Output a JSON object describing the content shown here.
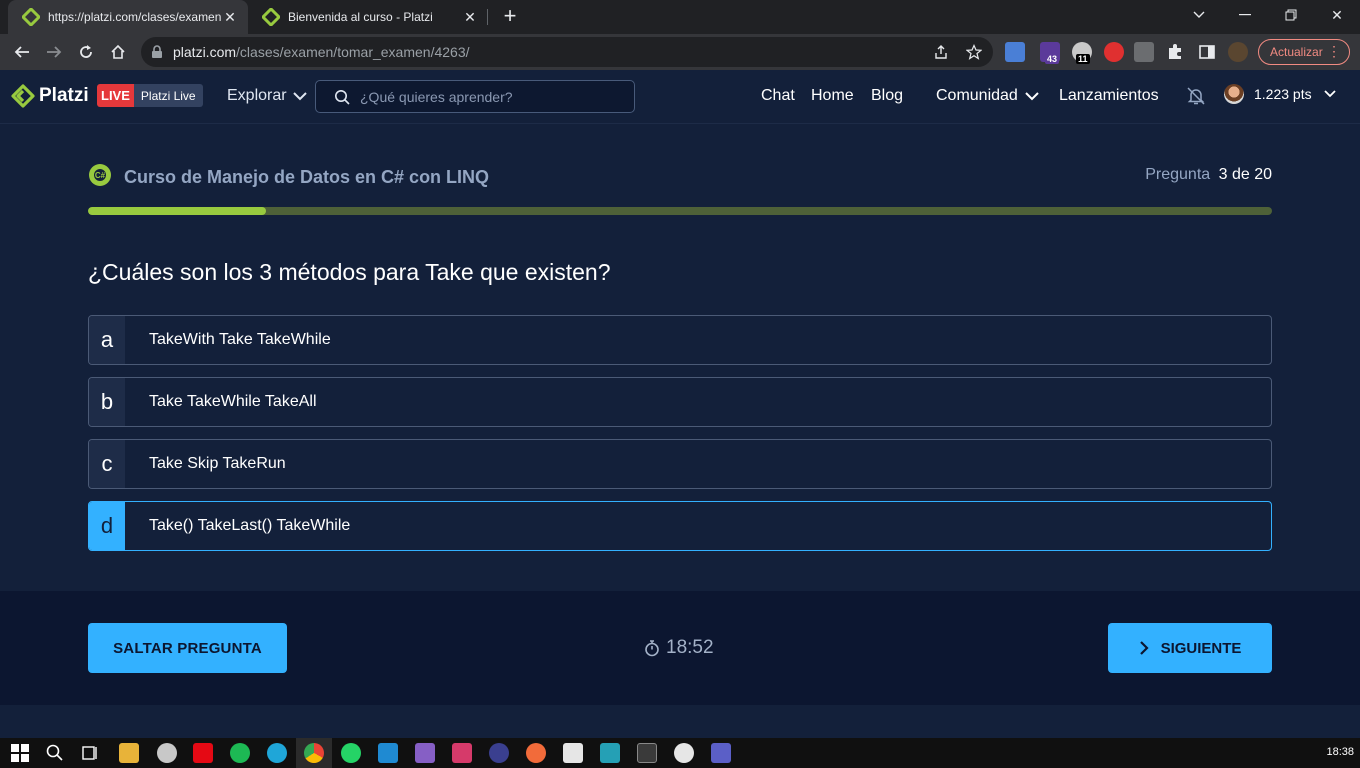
{
  "browser": {
    "tabs": [
      {
        "title": "https://platzi.com/clases/examen",
        "active": true
      },
      {
        "title": "Bienvenida al curso - Platzi",
        "active": false
      }
    ],
    "url_domain": "platzi.com",
    "url_path": "/clases/examen/tomar_examen/4263/",
    "update_label": "Actualizar",
    "extension_badges": [
      "43",
      "11"
    ]
  },
  "header": {
    "logo_text": "Platzi",
    "live_label": "LIVE",
    "live_sub": "Platzi Live",
    "explore_label": "Explorar",
    "search_placeholder": "¿Qué quieres aprender?",
    "nav": [
      "Chat",
      "Home",
      "Blog",
      "Comunidad",
      "Lanzamientos"
    ],
    "points": "1.223 pts"
  },
  "exam": {
    "course_title": "Curso de Manejo de Datos en C# con LINQ",
    "question_label": "Pregunta",
    "question_progress": "3 de 20",
    "progress_fraction": 0.15,
    "question": "¿Cuáles son los 3 métodos para Take que existen?",
    "options": [
      {
        "letter": "a",
        "text": "TakeWith Take TakeWhile",
        "selected": false
      },
      {
        "letter": "b",
        "text": "Take TakeWhile TakeAll",
        "selected": false
      },
      {
        "letter": "c",
        "text": "Take Skip TakeRun",
        "selected": false
      },
      {
        "letter": "d",
        "text": "Take() TakeLast() TakeWhile",
        "selected": true
      }
    ]
  },
  "footer": {
    "skip_label": "SALTAR PREGUNTA",
    "timer": "18:52",
    "next_label": "SIGUIENTE"
  },
  "taskbar": {
    "clock": "18:38"
  },
  "colors": {
    "accent": "#33b1ff",
    "brand_green": "#98ca3f",
    "background": "#13203a",
    "footer_bg": "#0c1630"
  }
}
